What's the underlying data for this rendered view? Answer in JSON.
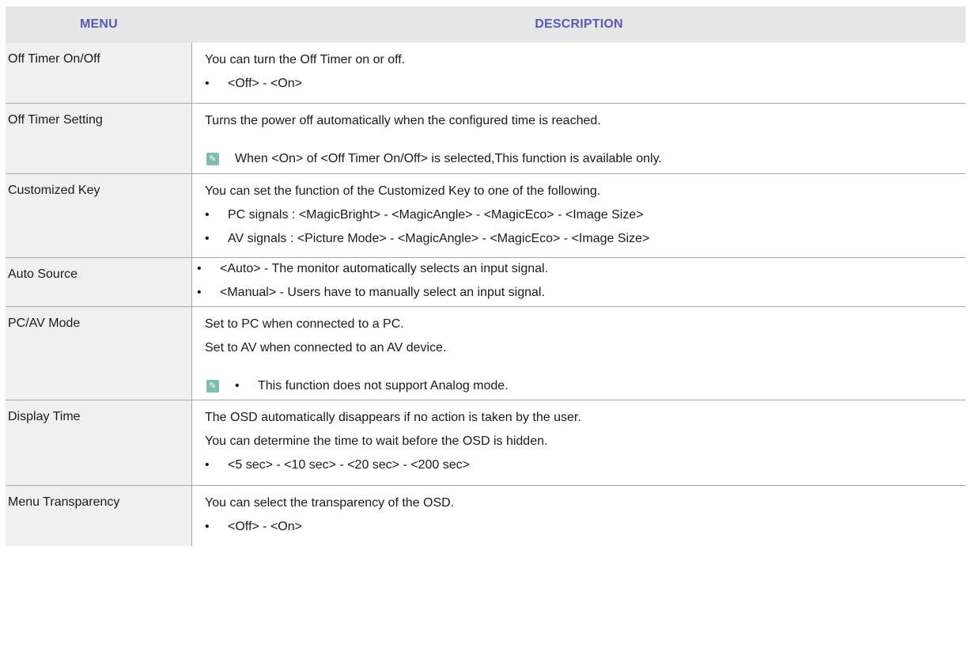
{
  "header": {
    "menu": "MENU",
    "description": "DESCRIPTION"
  },
  "rows": [
    {
      "menu": "Off Timer On/Off",
      "lines": [
        "You can turn the Off Timer on or off."
      ],
      "bullets": [
        "<Off> - <On>"
      ]
    },
    {
      "menu": "Off Timer Setting",
      "lines": [
        "Turns the power off automatically when the configured time is reached."
      ],
      "note": "When <On> of <Off Timer On/Off> is selected,This function is available only."
    },
    {
      "menu": "Customized Key",
      "lines": [
        "You can set the function of the Customized Key to one of the following."
      ],
      "bullets": [
        "PC signals : <MagicBright> - <MagicAngle> - <MagicEco> - <Image Size>",
        "AV signals : <Picture Mode> - <MagicAngle> - <MagicEco> - <Image Size>"
      ]
    },
    {
      "menu": "Auto Source",
      "bullets": [
        "<Auto> - The monitor automatically selects an input signal.",
        "<Manual> - Users have to manually select an input signal."
      ]
    },
    {
      "menu": "PC/AV Mode",
      "lines": [
        "Set to PC when connected to a PC.",
        "Set to AV when connected to an AV device."
      ],
      "note": "This function does not support Analog mode."
    },
    {
      "menu": "Display Time",
      "lines": [
        "The OSD automatically disappears if no action is taken by the user.",
        "You can determine the time to wait before the OSD is hidden."
      ],
      "bullets": [
        "<5 sec> - <10 sec> - <20 sec> - <200 sec>"
      ]
    },
    {
      "menu": "Menu Transparency",
      "lines": [
        "You can select the transparency of the OSD."
      ],
      "bullets": [
        "<Off> - <On>"
      ]
    }
  ],
  "bullet_char": "•",
  "note_icon_glyph": "✎",
  "colors": {
    "header_text": "#5a5ab4",
    "header_bg": "#e6e6e6",
    "menu_bg": "#f0f0f0",
    "note_icon": "#7fbcb2"
  }
}
